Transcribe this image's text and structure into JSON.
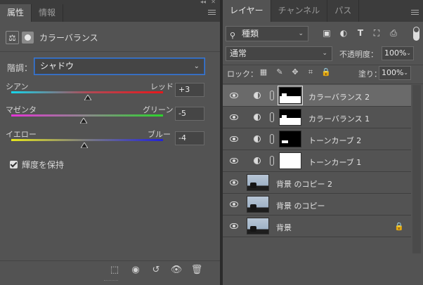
{
  "left_panel": {
    "tabs": [
      {
        "label": "属性"
      },
      {
        "label": "情報"
      }
    ],
    "title": "カラーバランス",
    "tone_label": "階調：",
    "tone_value": "シャドウ",
    "sliders": [
      {
        "left": "シアン",
        "right": "レッド",
        "value": "+3",
        "position": 0.503
      },
      {
        "left": "マゼンタ",
        "right": "グリーン",
        "value": "-5",
        "position": 0.475
      },
      {
        "left": "イエロー",
        "right": "ブルー",
        "value": "-4",
        "position": 0.48
      }
    ],
    "preserve_luminosity": "輝度を保持",
    "bottom_icons": [
      "clip-to-layer-icon",
      "view-previous-state-icon",
      "reset-icon",
      "visibility-icon",
      "trash-icon"
    ]
  },
  "right_panel": {
    "tabs": [
      {
        "label": "レイヤー"
      },
      {
        "label": "チャンネル"
      },
      {
        "label": "パス"
      }
    ],
    "filter_kind": "種類",
    "blend_mode": "通常",
    "opacity_label": "不透明度：",
    "opacity_value": "100%",
    "lock_label": "ロック：",
    "fill_label": "塗り：",
    "fill_value": "100%",
    "layers": [
      {
        "name": "カラーバランス 2",
        "kind": "adjustment",
        "selected": true
      },
      {
        "name": "カラーバランス 1",
        "kind": "adjustment",
        "selected": false
      },
      {
        "name": "トーンカーブ 2",
        "kind": "adjustment",
        "selected": false
      },
      {
        "name": "トーンカーブ 1",
        "kind": "adjustment",
        "selected": false
      },
      {
        "name": "背景 のコピー 2",
        "kind": "photo",
        "selected": false
      },
      {
        "name": "背景 のコピー",
        "kind": "photo",
        "selected": false
      },
      {
        "name": "背景",
        "kind": "photo",
        "selected": false,
        "locked": true
      }
    ]
  },
  "colors": {
    "panel_bg": "#535353",
    "tab_bar": "#3c3c3c",
    "selected_layer": "#6a6a6a",
    "focus_blue": "#3d7bd6"
  }
}
